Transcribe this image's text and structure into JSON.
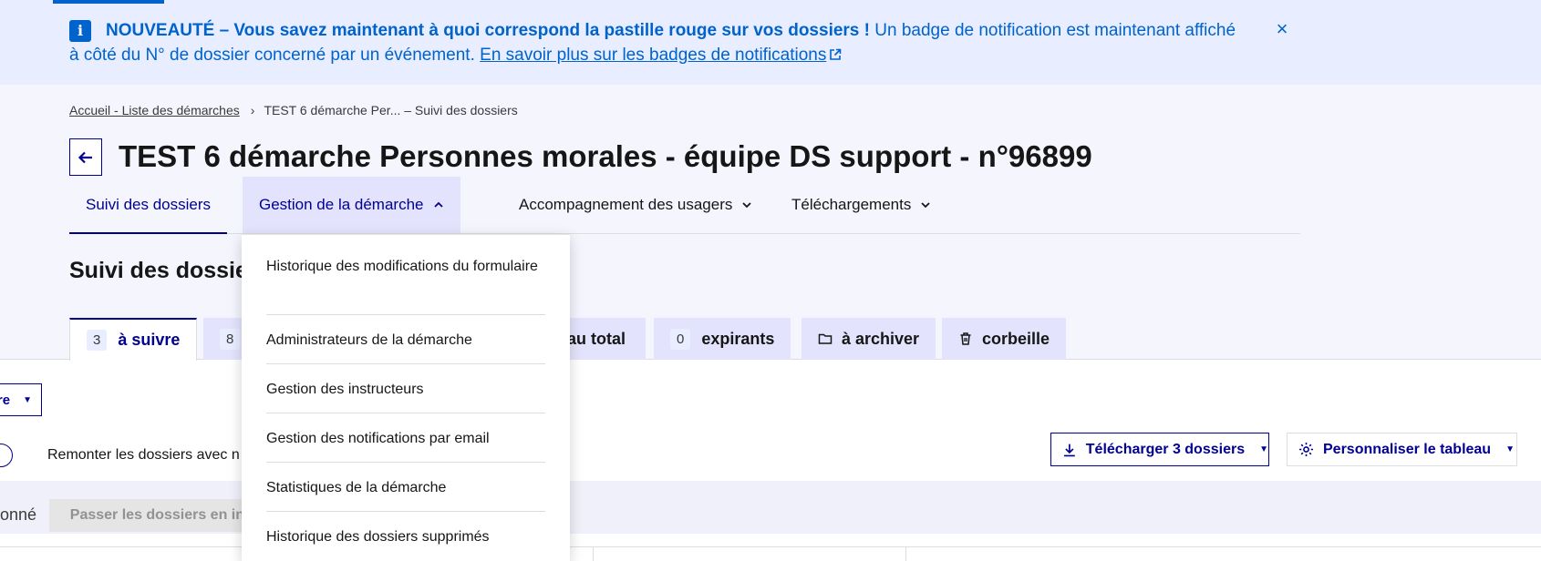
{
  "notice": {
    "title": "NOUVEAUTÉ – Vous savez maintenant à quoi correspond la pastille rouge sur vos dossiers !",
    "body": "Un badge de notification est maintenant affiché à côté du N° de dossier concerné par un événement.",
    "link": "En savoir plus sur les badges de notifications",
    "close": "×",
    "icon": "info-icon",
    "color": "#0063cb"
  },
  "breadcrumb": {
    "home": "Accueil - Liste des démarches",
    "current": "TEST 6 démarche Per... – Suivi des dossiers",
    "separator": "›"
  },
  "page": {
    "title": "TEST 6 démarche Personnes morales - équipe DS support - n°96899",
    "section_title": "Suivi des dossiers"
  },
  "nav": {
    "items": [
      {
        "label": "Suivi des dossiers"
      },
      {
        "label": "Gestion de la démarche"
      },
      {
        "label": "Accompagnement des usagers"
      },
      {
        "label": "Téléchargements"
      }
    ]
  },
  "dropdown": {
    "items": [
      {
        "label": "Historique des modifications du formulaire"
      },
      {
        "label": "Administrateurs de la démarche"
      },
      {
        "label": "Gestion des instructeurs"
      },
      {
        "label": "Gestion des notifications par email"
      },
      {
        "label": "Statistiques de la démarche"
      },
      {
        "label": "Historique des dossiers supprimés"
      }
    ]
  },
  "tabs": [
    {
      "count": "3",
      "label": "à suivre"
    },
    {
      "count": "8",
      "label": ""
    },
    {
      "label": "au total"
    },
    {
      "count": "0",
      "label": "expirants"
    },
    {
      "label": "à archiver",
      "icon": "folder-icon"
    },
    {
      "label": "corbeille",
      "icon": "trash-icon"
    }
  ],
  "toolbar": {
    "filter_label": "re",
    "toggle_label": "Remonter les dossiers avec n",
    "download_label": "Télécharger 3 dossiers",
    "customize_label": "Personnaliser le tableau"
  },
  "selection": {
    "label": "onné",
    "bulk_label": "Passer les dossiers en in"
  },
  "colors": {
    "primary": "#000091",
    "banner_bg": "#e8edff",
    "tab_bg": "#e3e3fd"
  }
}
